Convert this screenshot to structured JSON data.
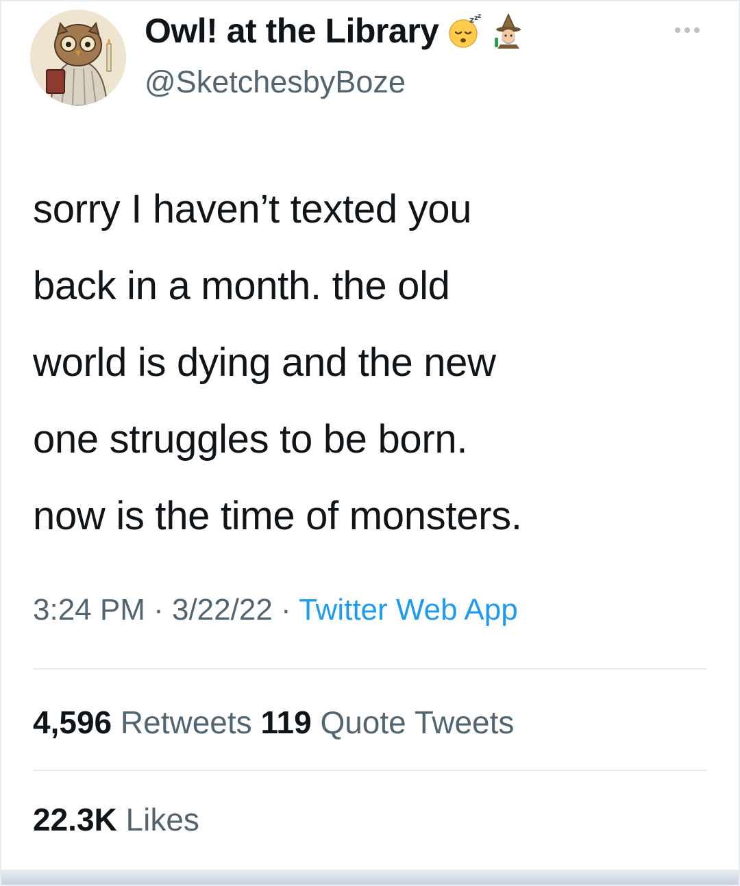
{
  "author": {
    "display_name": "Owl! at the Library",
    "handle": "@SketchesbyBoze",
    "name_emojis": [
      "sleeping-face-emoji",
      "wizard-emoji"
    ],
    "avatar": "owl-in-pajamas-avatar"
  },
  "menu": {
    "icon": "more-options-icon"
  },
  "tweet": {
    "lines": [
      "sorry I haven’t texted you",
      "back in a month. the old",
      "world is dying and the new",
      "one struggles to be born.",
      "now is the time of monsters."
    ]
  },
  "meta": {
    "time": "3:24 PM",
    "sep1": " · ",
    "date": "3/22/22",
    "sep2": " · ",
    "source": "Twitter Web App"
  },
  "stats": {
    "retweets_count": "4,596",
    "retweets_label": "Retweets",
    "quotes_count": "119",
    "quotes_label": "Quote Tweets",
    "likes_count": "22.3K",
    "likes_label": "Likes"
  },
  "colors": {
    "text": "#0f1419",
    "secondary": "#536471",
    "link": "#1d9bf0",
    "divider": "#e6ecf0"
  }
}
